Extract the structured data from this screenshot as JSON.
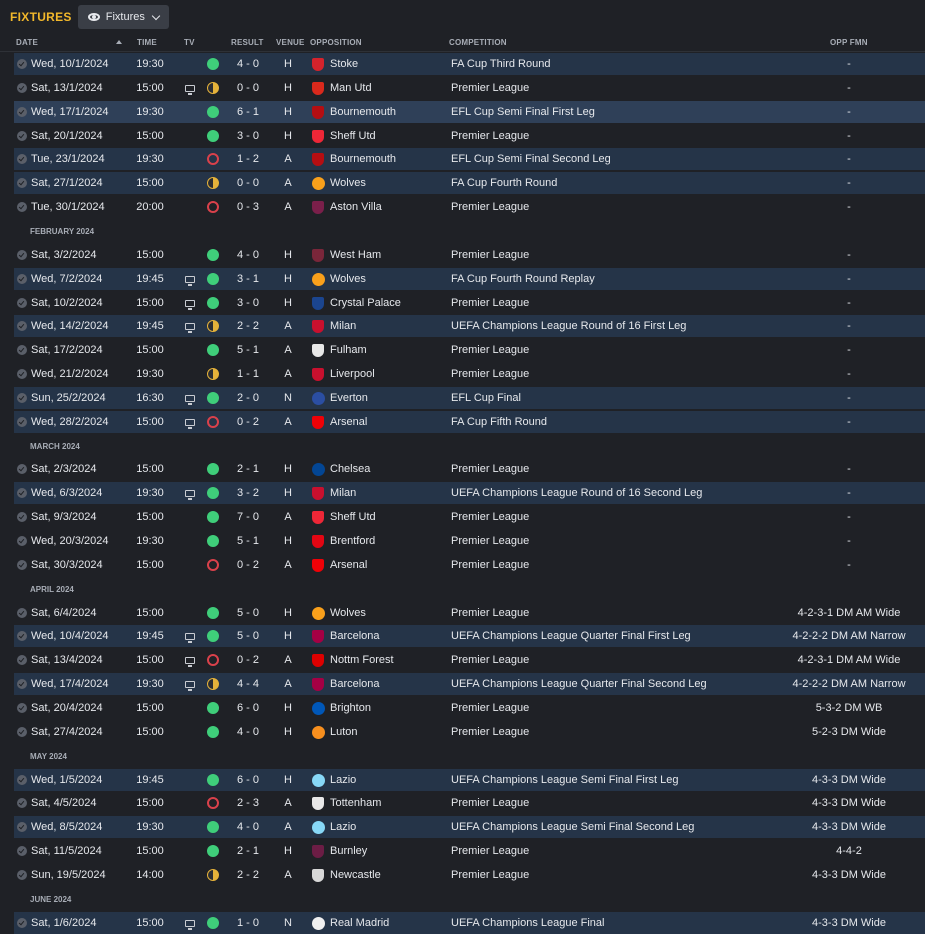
{
  "topbar": {
    "title": "FIXTURES",
    "view_label": "Fixtures"
  },
  "columns": {
    "date": "DATE",
    "time": "TIME",
    "tv": "TV",
    "result": "RESULT",
    "venue": "VENUE",
    "opposition": "OPPOSITION",
    "competition": "COMPETITION",
    "opp_fmn": "OPP FMN"
  },
  "rows": [
    {
      "kind": "match",
      "date": "Wed, 10/1/2024",
      "time": "19:30",
      "tv": false,
      "res": "W",
      "score": "4 - 0",
      "venue": "H",
      "opp": "Stoke",
      "crest": "#d4232c",
      "comp": "FA Cup Third Round",
      "fmn": "-",
      "bg": "hl"
    },
    {
      "kind": "match",
      "date": "Sat, 13/1/2024",
      "time": "15:00",
      "tv": true,
      "res": "D",
      "score": "0 - 0",
      "venue": "H",
      "opp": "Man Utd",
      "crest": "#da291c",
      "comp": "Premier League",
      "fmn": "-",
      "bg": "odd"
    },
    {
      "kind": "match",
      "date": "Wed, 17/1/2024",
      "time": "19:30",
      "tv": false,
      "res": "W",
      "score": "6 - 1",
      "venue": "H",
      "opp": "Bournemouth",
      "crest": "#b50e12",
      "comp": "EFL Cup Semi Final First Leg",
      "fmn": "-",
      "bg": "sel"
    },
    {
      "kind": "match",
      "date": "Sat, 20/1/2024",
      "time": "15:00",
      "tv": false,
      "res": "W",
      "score": "3 - 0",
      "venue": "H",
      "opp": "Sheff Utd",
      "crest": "#ee2737",
      "comp": "Premier League",
      "fmn": "-",
      "bg": "odd"
    },
    {
      "kind": "match",
      "date": "Tue, 23/1/2024",
      "time": "19:30",
      "tv": false,
      "res": "L",
      "score": "1 - 2",
      "venue": "A",
      "opp": "Bournemouth",
      "crest": "#b50e12",
      "comp": "EFL Cup Semi Final Second Leg",
      "fmn": "-",
      "bg": "hl"
    },
    {
      "kind": "match",
      "date": "Sat, 27/1/2024",
      "time": "15:00",
      "tv": false,
      "res": "D",
      "score": "0 - 0",
      "venue": "A",
      "opp": "Wolves",
      "crest": "#f9a01b",
      "comp": "FA Cup Fourth Round",
      "fmn": "-",
      "bg": "hl"
    },
    {
      "kind": "match",
      "date": "Tue, 30/1/2024",
      "time": "20:00",
      "tv": false,
      "res": "L",
      "score": "0 - 3",
      "venue": "A",
      "opp": "Aston Villa",
      "crest": "#7a1f4a",
      "comp": "Premier League",
      "fmn": "-",
      "bg": "odd"
    },
    {
      "kind": "month",
      "label": "FEBRUARY 2024"
    },
    {
      "kind": "match",
      "date": "Sat, 3/2/2024",
      "time": "15:00",
      "tv": false,
      "res": "W",
      "score": "4 - 0",
      "venue": "H",
      "opp": "West Ham",
      "crest": "#7a263a",
      "comp": "Premier League",
      "fmn": "-",
      "bg": "odd"
    },
    {
      "kind": "match",
      "date": "Wed, 7/2/2024",
      "time": "19:45",
      "tv": true,
      "res": "W",
      "score": "3 - 1",
      "venue": "H",
      "opp": "Wolves",
      "crest": "#f9a01b",
      "comp": "FA Cup Fourth Round Replay",
      "fmn": "-",
      "bg": "hl"
    },
    {
      "kind": "match",
      "date": "Sat, 10/2/2024",
      "time": "15:00",
      "tv": true,
      "res": "W",
      "score": "3 - 0",
      "venue": "H",
      "opp": "Crystal Palace",
      "crest": "#1b458f",
      "comp": "Premier League",
      "fmn": "-",
      "bg": "odd"
    },
    {
      "kind": "match",
      "date": "Wed, 14/2/2024",
      "time": "19:45",
      "tv": true,
      "res": "D",
      "score": "2 - 2",
      "venue": "A",
      "opp": "Milan",
      "crest": "#c8102e",
      "comp": "UEFA Champions League Round of 16 First Leg",
      "fmn": "-",
      "bg": "hl"
    },
    {
      "kind": "match",
      "date": "Sat, 17/2/2024",
      "time": "15:00",
      "tv": false,
      "res": "W",
      "score": "5 - 1",
      "venue": "A",
      "opp": "Fulham",
      "crest": "#e8e8e8",
      "comp": "Premier League",
      "fmn": "-",
      "bg": "odd"
    },
    {
      "kind": "match",
      "date": "Wed, 21/2/2024",
      "time": "19:30",
      "tv": false,
      "res": "D",
      "score": "1 - 1",
      "venue": "A",
      "opp": "Liverpool",
      "crest": "#c8102e",
      "comp": "Premier League",
      "fmn": "-",
      "bg": "odd"
    },
    {
      "kind": "match",
      "date": "Sun, 25/2/2024",
      "time": "16:30",
      "tv": true,
      "res": "W",
      "score": "2 - 0",
      "venue": "N",
      "opp": "Everton",
      "crest": "#2b4ea2",
      "comp": "EFL Cup Final",
      "fmn": "-",
      "bg": "hl"
    },
    {
      "kind": "match",
      "date": "Wed, 28/2/2024",
      "time": "15:00",
      "tv": true,
      "res": "L",
      "score": "0 - 2",
      "venue": "A",
      "opp": "Arsenal",
      "crest": "#ef0107",
      "comp": "FA Cup Fifth Round",
      "fmn": "-",
      "bg": "hl"
    },
    {
      "kind": "month",
      "label": "MARCH 2024"
    },
    {
      "kind": "match",
      "date": "Sat, 2/3/2024",
      "time": "15:00",
      "tv": false,
      "res": "W",
      "score": "2 - 1",
      "venue": "H",
      "opp": "Chelsea",
      "crest": "#034694",
      "comp": "Premier League",
      "fmn": "-",
      "bg": "odd"
    },
    {
      "kind": "match",
      "date": "Wed, 6/3/2024",
      "time": "19:30",
      "tv": true,
      "res": "W",
      "score": "3 - 2",
      "venue": "H",
      "opp": "Milan",
      "crest": "#c8102e",
      "comp": "UEFA Champions League Round of 16 Second Leg",
      "fmn": "-",
      "bg": "hl"
    },
    {
      "kind": "match",
      "date": "Sat, 9/3/2024",
      "time": "15:00",
      "tv": false,
      "res": "W",
      "score": "7 - 0",
      "venue": "A",
      "opp": "Sheff Utd",
      "crest": "#ee2737",
      "comp": "Premier League",
      "fmn": "-",
      "bg": "odd"
    },
    {
      "kind": "match",
      "date": "Wed, 20/3/2024",
      "time": "19:30",
      "tv": false,
      "res": "W",
      "score": "5 - 1",
      "venue": "H",
      "opp": "Brentford",
      "crest": "#e30613",
      "comp": "Premier League",
      "fmn": "-",
      "bg": "odd"
    },
    {
      "kind": "match",
      "date": "Sat, 30/3/2024",
      "time": "15:00",
      "tv": false,
      "res": "L",
      "score": "0 - 2",
      "venue": "A",
      "opp": "Arsenal",
      "crest": "#ef0107",
      "comp": "Premier League",
      "fmn": "-",
      "bg": "odd"
    },
    {
      "kind": "month",
      "label": "APRIL 2024"
    },
    {
      "kind": "match",
      "date": "Sat, 6/4/2024",
      "time": "15:00",
      "tv": false,
      "res": "W",
      "score": "5 - 0",
      "venue": "H",
      "opp": "Wolves",
      "crest": "#f9a01b",
      "comp": "Premier League",
      "fmn": "4-2-3-1 DM AM Wide",
      "bg": "odd"
    },
    {
      "kind": "match",
      "date": "Wed, 10/4/2024",
      "time": "19:45",
      "tv": true,
      "res": "W",
      "score": "5 - 0",
      "venue": "H",
      "opp": "Barcelona",
      "crest": "#a50044",
      "comp": "UEFA Champions League Quarter Final First Leg",
      "fmn": "4-2-2-2 DM AM Narrow",
      "bg": "hl"
    },
    {
      "kind": "match",
      "date": "Sat, 13/4/2024",
      "time": "15:00",
      "tv": true,
      "res": "L",
      "score": "0 - 2",
      "venue": "A",
      "opp": "Nottm Forest",
      "crest": "#dd0000",
      "comp": "Premier League",
      "fmn": "4-2-3-1 DM AM Wide",
      "bg": "odd"
    },
    {
      "kind": "match",
      "date": "Wed, 17/4/2024",
      "time": "19:30",
      "tv": true,
      "res": "D",
      "score": "4 - 4",
      "venue": "A",
      "opp": "Barcelona",
      "crest": "#a50044",
      "comp": "UEFA Champions League Quarter Final Second Leg",
      "fmn": "4-2-2-2 DM AM Narrow",
      "bg": "hl"
    },
    {
      "kind": "match",
      "date": "Sat, 20/4/2024",
      "time": "15:00",
      "tv": false,
      "res": "W",
      "score": "6 - 0",
      "venue": "H",
      "opp": "Brighton",
      "crest": "#0057b8",
      "comp": "Premier League",
      "fmn": "5-3-2 DM WB",
      "bg": "odd"
    },
    {
      "kind": "match",
      "date": "Sat, 27/4/2024",
      "time": "15:00",
      "tv": false,
      "res": "W",
      "score": "4 - 0",
      "venue": "H",
      "opp": "Luton",
      "crest": "#f78f1e",
      "comp": "Premier League",
      "fmn": "5-2-3 DM Wide",
      "bg": "odd"
    },
    {
      "kind": "month",
      "label": "MAY 2024"
    },
    {
      "kind": "match",
      "date": "Wed, 1/5/2024",
      "time": "19:45",
      "tv": false,
      "res": "W",
      "score": "6 - 0",
      "venue": "H",
      "opp": "Lazio",
      "crest": "#87d8f7",
      "comp": "UEFA Champions League Semi Final First Leg",
      "fmn": "4-3-3 DM Wide",
      "bg": "hl"
    },
    {
      "kind": "match",
      "date": "Sat, 4/5/2024",
      "time": "15:00",
      "tv": false,
      "res": "L",
      "score": "2 - 3",
      "venue": "A",
      "opp": "Tottenham",
      "crest": "#e8e8e8",
      "comp": "Premier League",
      "fmn": "4-3-3 DM Wide",
      "bg": "odd"
    },
    {
      "kind": "match",
      "date": "Wed, 8/5/2024",
      "time": "19:30",
      "tv": false,
      "res": "W",
      "score": "4 - 0",
      "venue": "A",
      "opp": "Lazio",
      "crest": "#87d8f7",
      "comp": "UEFA Champions League Semi Final Second Leg",
      "fmn": "4-3-3 DM Wide",
      "bg": "hl"
    },
    {
      "kind": "match",
      "date": "Sat, 11/5/2024",
      "time": "15:00",
      "tv": false,
      "res": "W",
      "score": "2 - 1",
      "venue": "H",
      "opp": "Burnley",
      "crest": "#6c1d45",
      "comp": "Premier League",
      "fmn": "4-4-2",
      "bg": "odd"
    },
    {
      "kind": "match",
      "date": "Sun, 19/5/2024",
      "time": "14:00",
      "tv": false,
      "res": "D",
      "score": "2 - 2",
      "venue": "A",
      "opp": "Newcastle",
      "crest": "#d8d8d8",
      "comp": "Premier League",
      "fmn": "4-3-3 DM Wide",
      "bg": "odd"
    },
    {
      "kind": "month",
      "label": "JUNE 2024"
    },
    {
      "kind": "match",
      "date": "Sat, 1/6/2024",
      "time": "15:00",
      "tv": true,
      "res": "W",
      "score": "1 - 0",
      "venue": "N",
      "opp": "Real Madrid",
      "crest": "#f0f0f0",
      "comp": "UEFA Champions League Final",
      "fmn": "4-3-3 DM Wide",
      "bg": "hl"
    }
  ]
}
